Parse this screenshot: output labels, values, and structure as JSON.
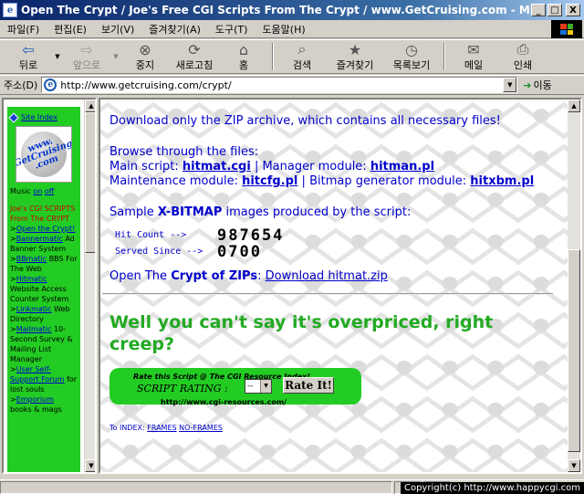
{
  "window": {
    "title": "Open The Crypt / Joe's Free CGI Scripts From The Crypt / www.GetCruising.com - Micr...",
    "minimize": "_",
    "maximize": "□",
    "close": "X"
  },
  "menu": [
    "파일(F)",
    "편집(E)",
    "보기(V)",
    "즐겨찾기(A)",
    "도구(T)",
    "도움말(H)"
  ],
  "toolbar": {
    "back": "뒤로",
    "forward": "앞으로",
    "stop": "중지",
    "refresh": "새로고침",
    "home": "홈",
    "search": "검색",
    "favorites": "즐겨찾기",
    "history": "목록보기",
    "mail": "메일",
    "print": "인쇄"
  },
  "address": {
    "label": "주소(D)",
    "url": "http://www.getcruising.com/crypt/",
    "go": "이동"
  },
  "sidebar": {
    "site_index": "Site Index",
    "logo_text_1": "www.",
    "logo_text_2": "GetCruising",
    "logo_text_3": ".com",
    "music_label": "Music",
    "music_on": "on",
    "music_off": "off",
    "header": "Joe's CGI SCRIPTS From The CRYPT",
    "items": [
      {
        "link": "Open the Crypt!",
        "desc": ""
      },
      {
        "link": "Bannermatic",
        "desc": "Ad Banner System"
      },
      {
        "link": "BBmatic",
        "desc": "BBS For The Web"
      },
      {
        "link": "Hitmatic",
        "desc": "Website Access Counter System"
      },
      {
        "link": "Linkmatic",
        "desc": "Web Directory"
      },
      {
        "link": "Mailmatic",
        "desc": "10-Second Survey & Mailing List Manager"
      },
      {
        "link": "User Self-Support Forum",
        "desc": "for lost souls"
      },
      {
        "link": "Emporium",
        "desc": "books & mags"
      }
    ]
  },
  "main": {
    "intro": "Download only the ZIP archive, which contains all necessary files!",
    "browse": "Browse through the files:",
    "main_script_label": "Main script:",
    "main_script_link": "hitmat.cgi",
    "sep": "|",
    "manager_label": "Manager module:",
    "manager_link": "hitman.pl",
    "maintenance_label": "Maintenance module:",
    "maintenance_link": "hitcfg.pl",
    "bitmap_label": "Bitmap generator module:",
    "bitmap_link": "hitxbm.pl",
    "sample_pre": "Sample",
    "sample_bold": "X-BITMAP",
    "sample_post": "images produced by the script:",
    "hit_count_label": "Hit Count   -->",
    "hit_count_value": "987654",
    "served_since_label": "Served Since -->",
    "served_since_value": "0700",
    "open_pre": "Open The",
    "open_bold": "Crypt of ZIPs",
    "open_colon": ":",
    "download_link": "Download hitmat.zip",
    "slogan": "Well you can't say it's overpriced, right creep?",
    "rating_title": "Rate this Script @ The CGI Resource Index!",
    "rating_label": "SCRIPT RATING :",
    "rating_value": "--",
    "rate_button": "Rate It!",
    "rating_url": "http://www.cgi-resources.com/",
    "index_label": "To INDEX:",
    "frames_link": "FRAMES",
    "noframes_link": "NO-FRAMES"
  },
  "status": {
    "copyright": "Copyright(c) http://www.happycgi.com"
  }
}
